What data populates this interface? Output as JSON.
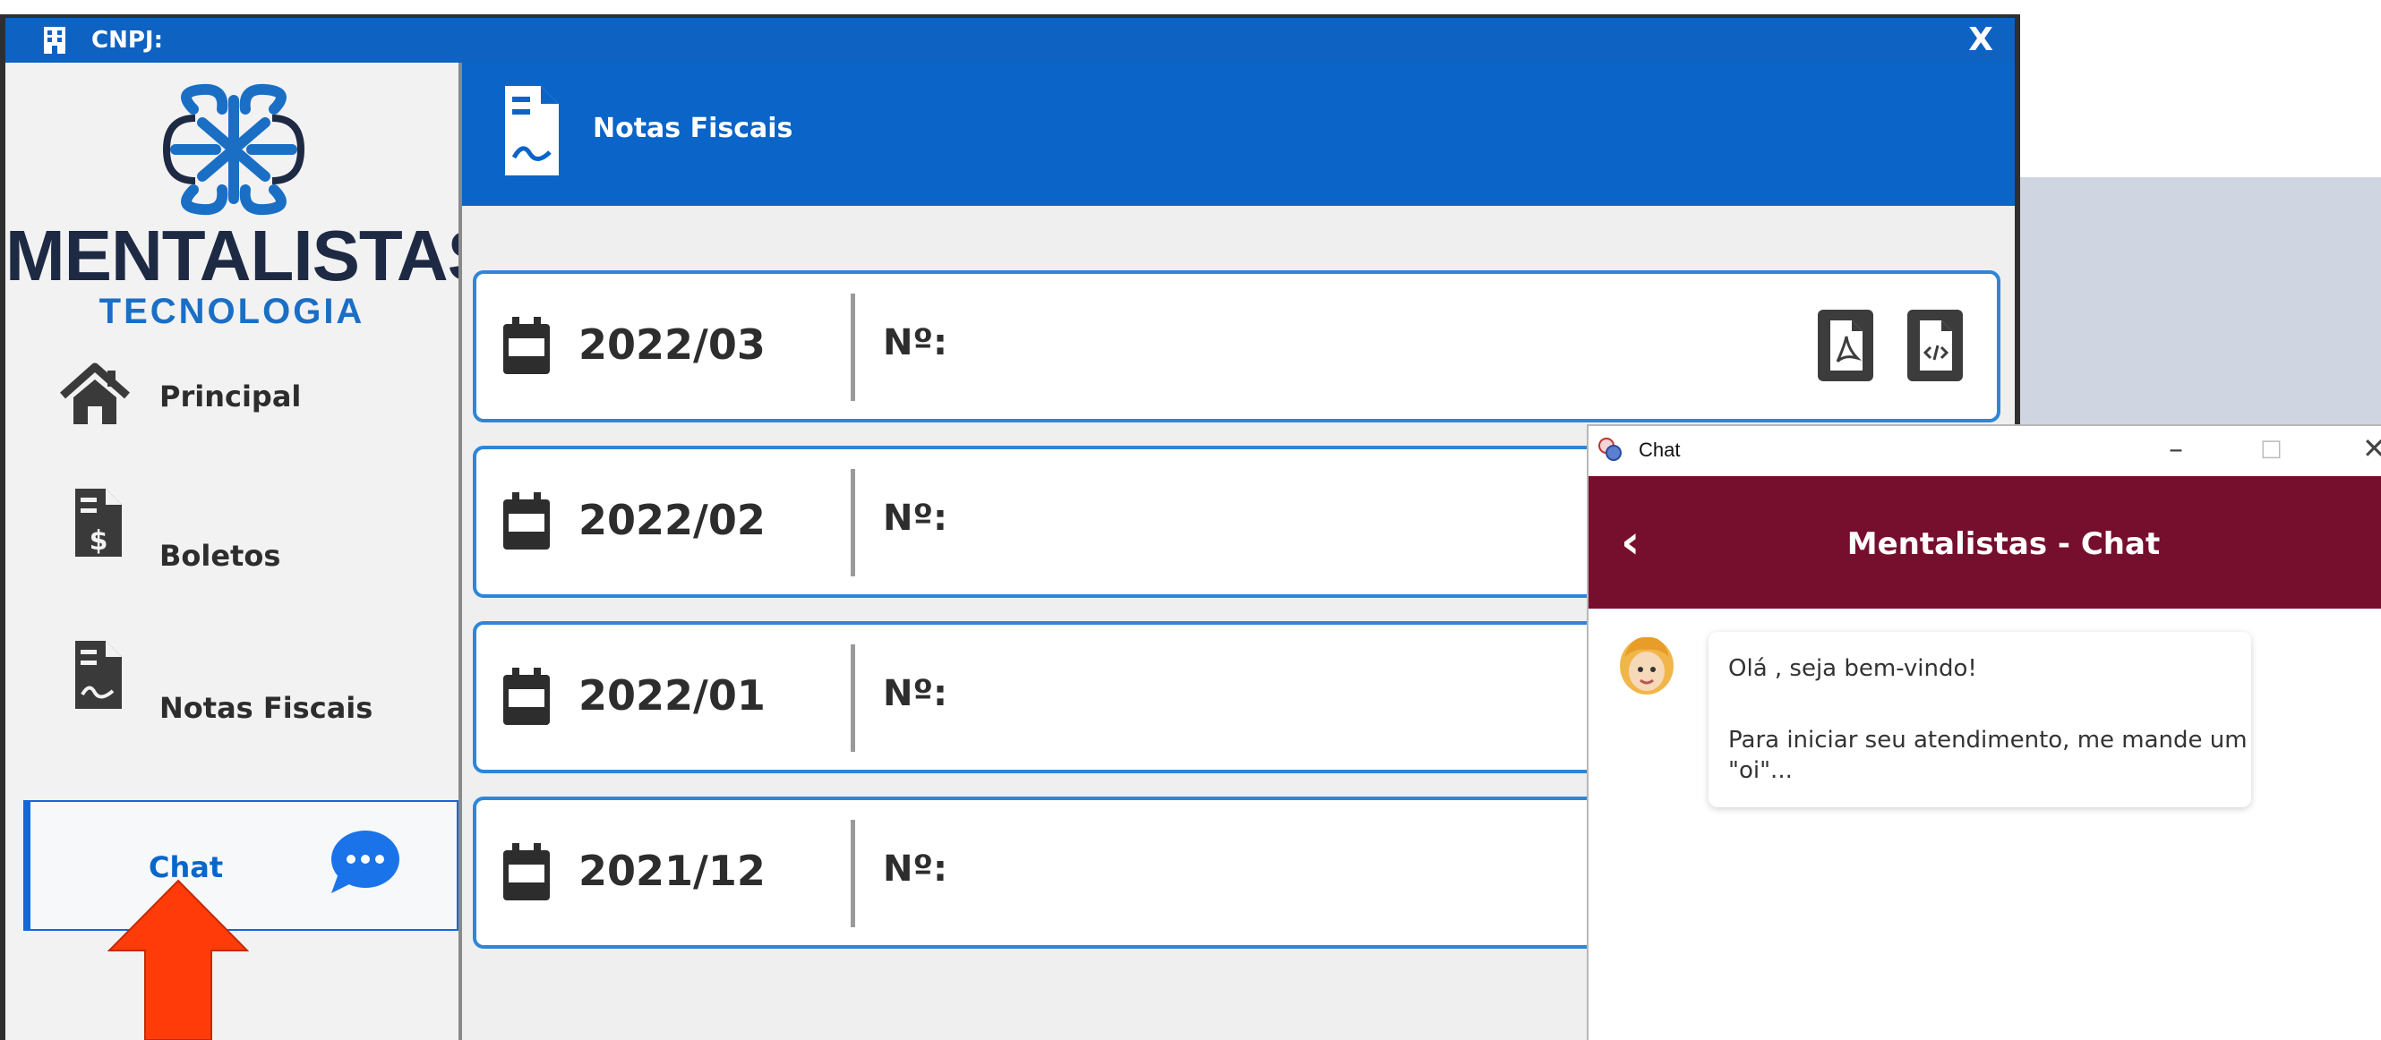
{
  "window": {
    "title": "CNPJ:",
    "close_label": "X"
  },
  "logo": {
    "name": "MENTALISTAS",
    "subtitle": "TECNOLOGIA"
  },
  "sidebar": {
    "items": [
      {
        "label": "Principal",
        "icon": "home-icon"
      },
      {
        "label": "Boletos",
        "icon": "boleto-document-icon"
      },
      {
        "label": "Notas Fiscais",
        "icon": "invoice-document-icon"
      },
      {
        "label": "Chat",
        "icon": "chat-bubble-icon",
        "active": true
      }
    ]
  },
  "main": {
    "header_title": "Notas Fiscais",
    "invoices": [
      {
        "date": "2022/03",
        "number_label": "Nº:"
      },
      {
        "date": "2022/02",
        "number_label": "Nº:"
      },
      {
        "date": "2022/01",
        "number_label": "Nº:"
      },
      {
        "date": "2021/12",
        "number_label": "Nº:"
      }
    ]
  },
  "chat": {
    "window_title": "Chat",
    "minimize_label": "–",
    "maximize_label": "□",
    "close_label": "✕",
    "header_title": "Mentalistas - Chat",
    "back_label": "‹",
    "message_line1": "Olá , seja bem-vindo!",
    "message_line2": "Para iniciar seu atendimento, me mande um \"oi\"..."
  },
  "colors": {
    "brand_blue": "#0b64c7",
    "chat_header": "#760f2e",
    "highlight_arrow": "#ff3b0a"
  }
}
